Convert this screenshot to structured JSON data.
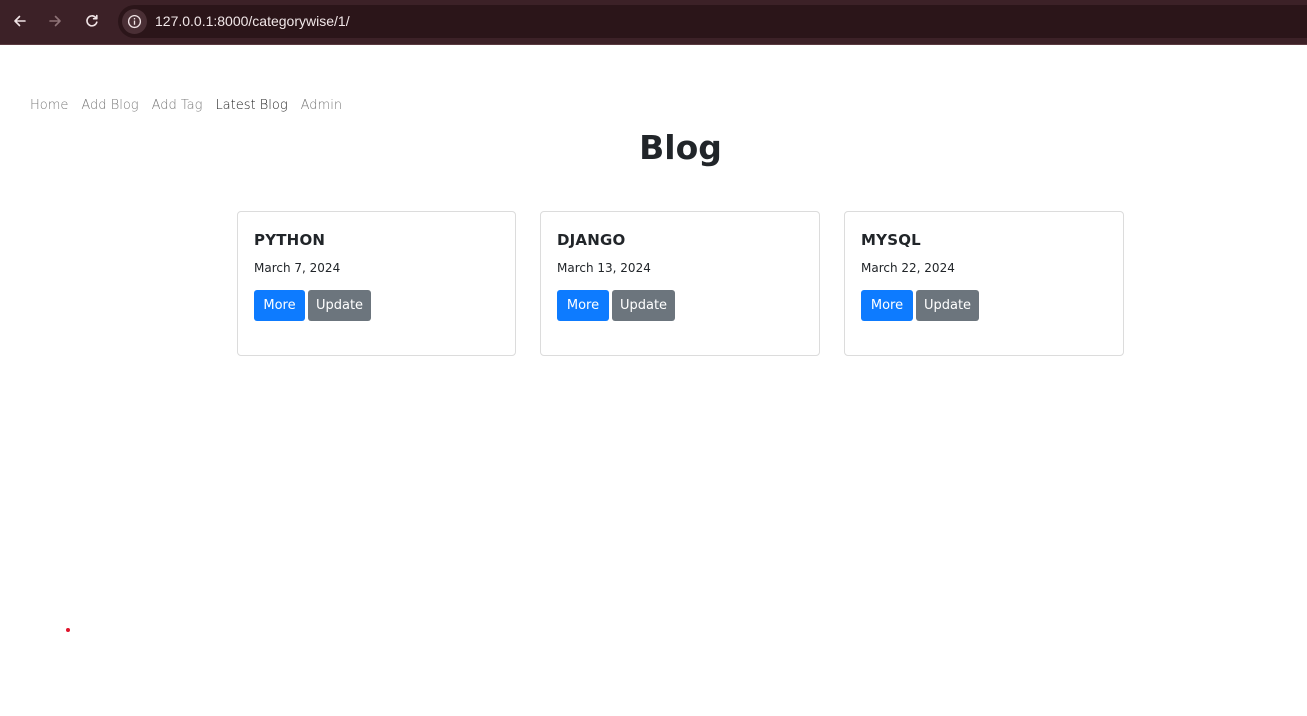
{
  "browser": {
    "url": "127.0.0.1:8000/categorywise/1/"
  },
  "nav": {
    "items": [
      {
        "label": "Home"
      },
      {
        "label": "Add Blog"
      },
      {
        "label": "Add Tag"
      },
      {
        "label": "Latest Blog"
      },
      {
        "label": "Admin"
      }
    ]
  },
  "page": {
    "title": "Blog"
  },
  "cards": [
    {
      "title": "PYTHON",
      "date": "March 7, 2024",
      "more_label": "More",
      "update_label": "Update"
    },
    {
      "title": "DJANGO",
      "date": "March 13, 2024",
      "more_label": "More",
      "update_label": "Update"
    },
    {
      "title": "MYSQL",
      "date": "March 22, 2024",
      "more_label": "More",
      "update_label": "Update"
    }
  ],
  "colors": {
    "chrome": "#3c2127",
    "primary": "#0d7bff",
    "secondary": "#6c757d"
  }
}
